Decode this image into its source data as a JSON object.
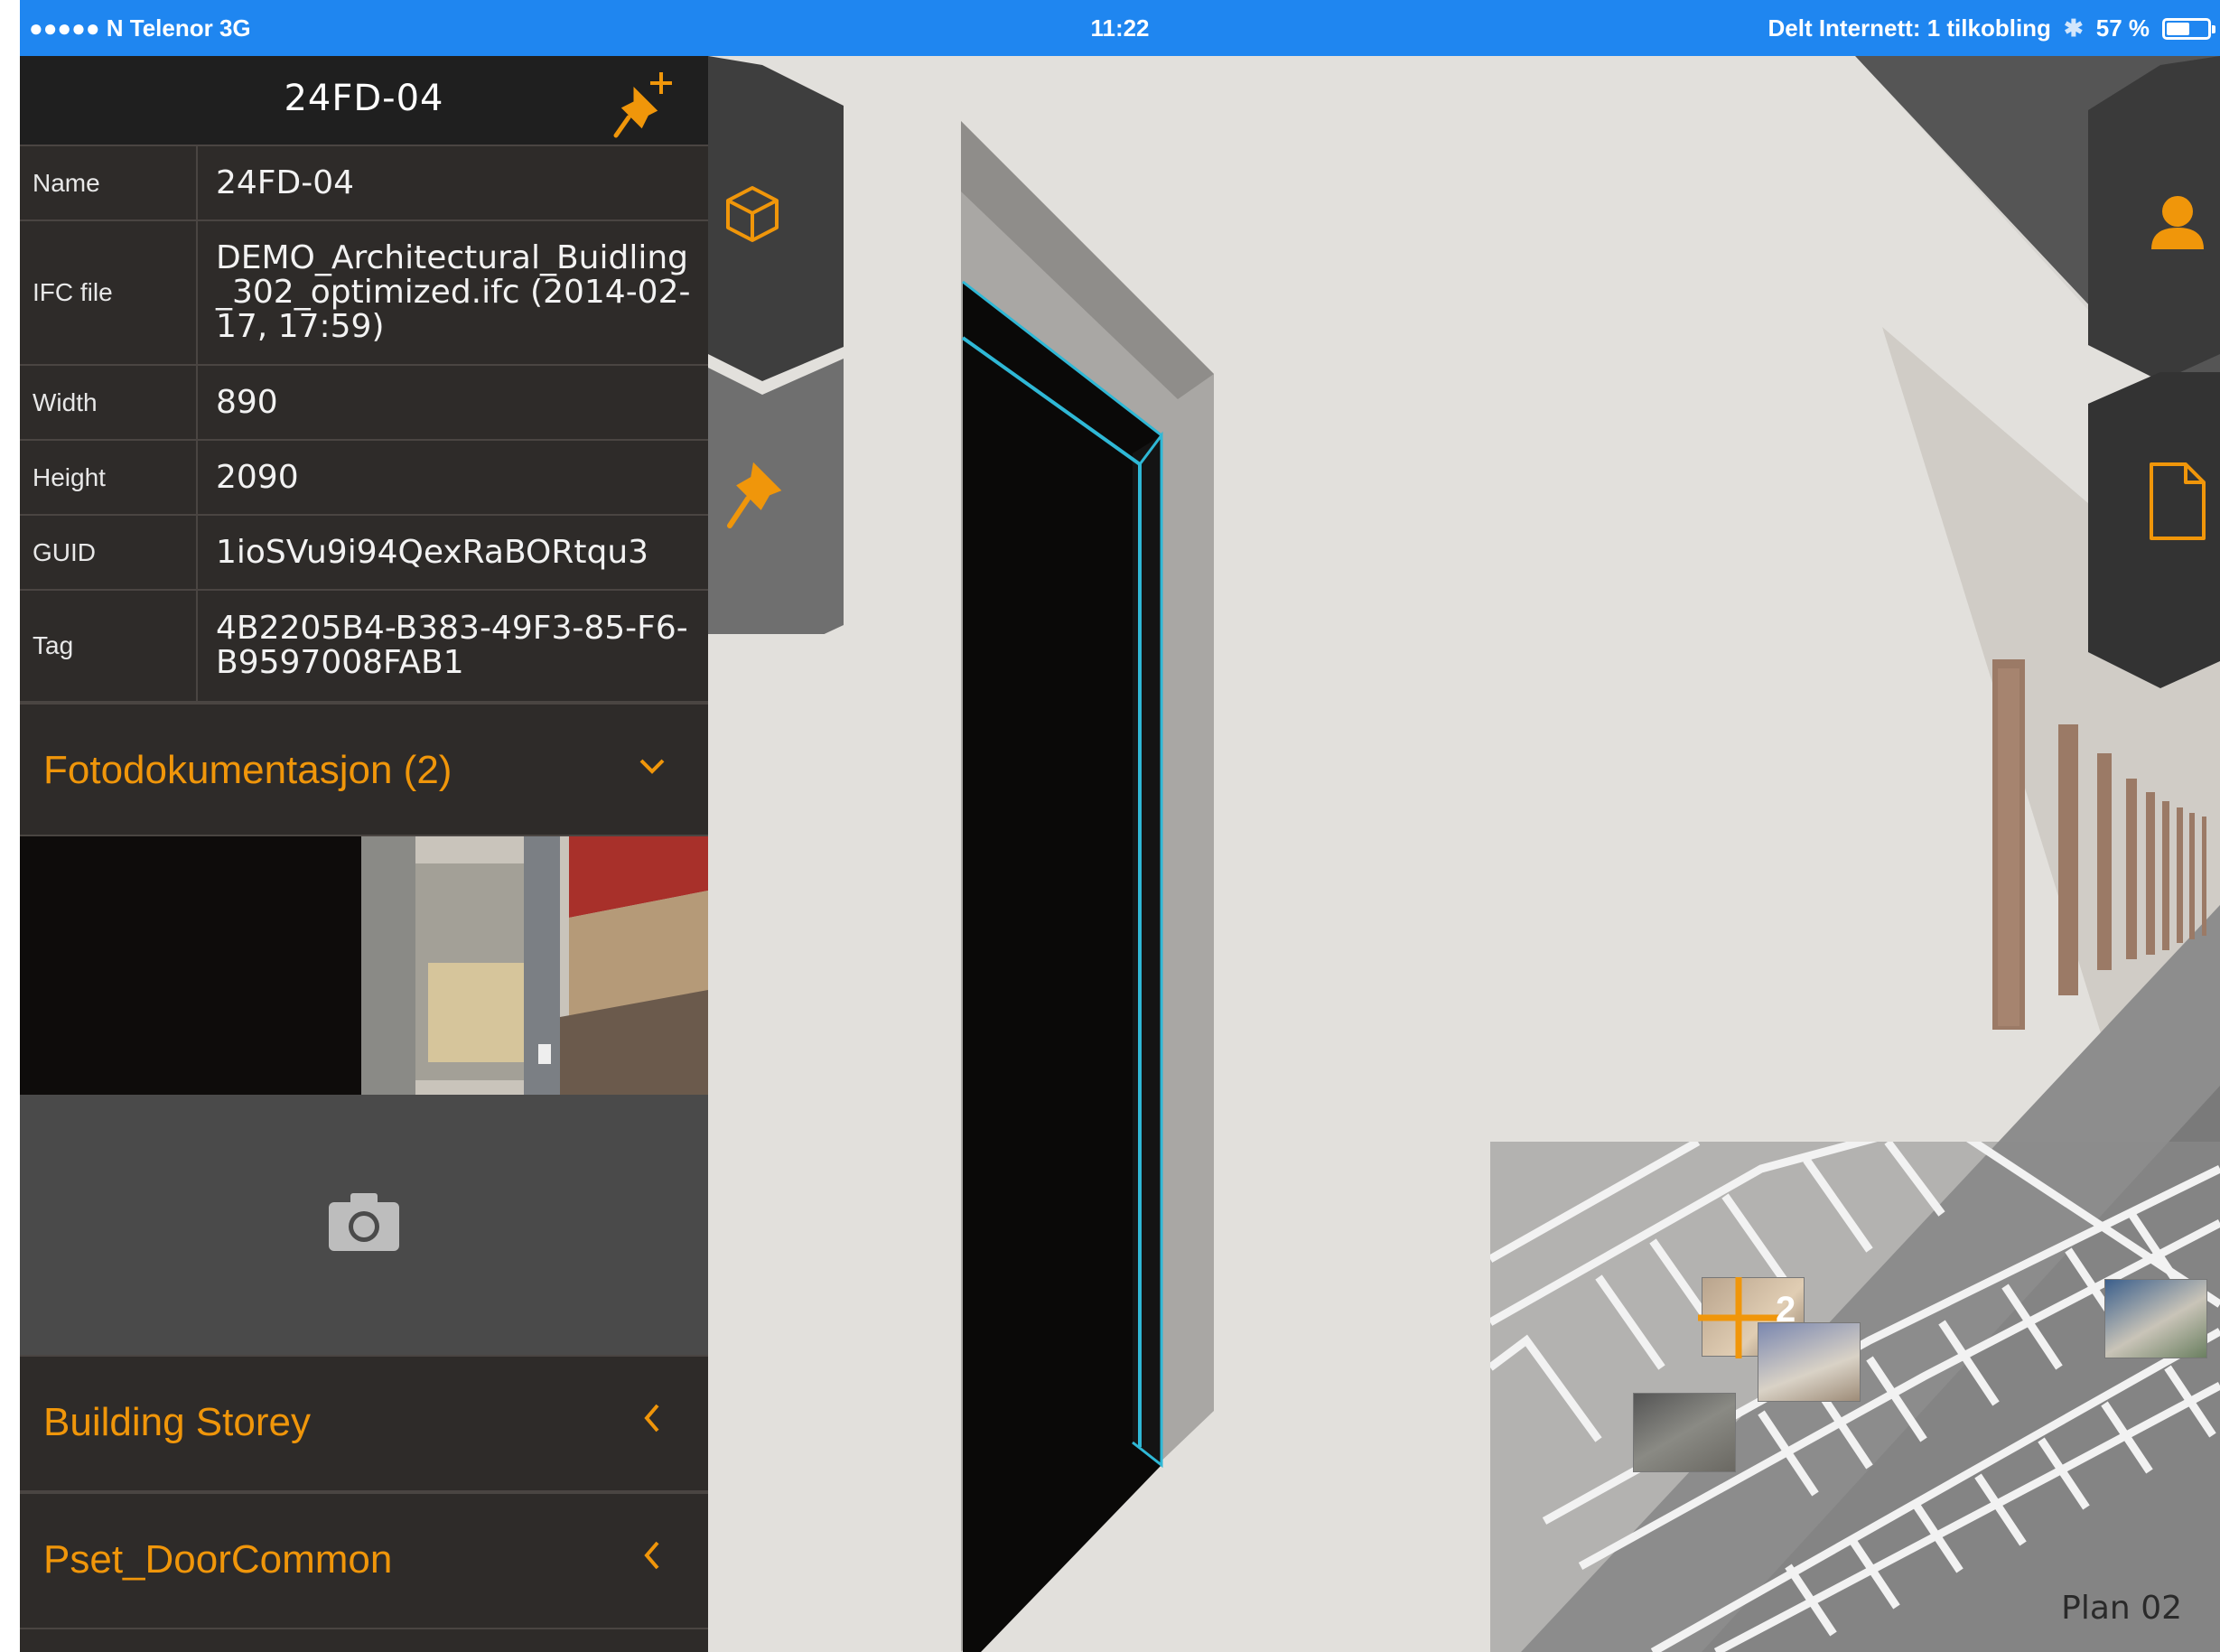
{
  "status_bar": {
    "carrier": "●●●●● N Telenor   3G",
    "time": "11:22",
    "hotspot": "Delt Internett: 1 tilkobling",
    "battery": "57 %",
    "battery_level": 0.57
  },
  "panel": {
    "title": "24FD-04",
    "properties": [
      {
        "key": "Name",
        "value": "24FD-04"
      },
      {
        "key": "IFC file",
        "value": "DEMO_Architectural_Buidling_302_optimized.ifc (2014-02-17, 17:59)"
      },
      {
        "key": "Width",
        "value": "890"
      },
      {
        "key": "Height",
        "value": "2090"
      },
      {
        "key": "GUID",
        "value": "1ioSVu9i94QexRaBORtqu3"
      },
      {
        "key": "Tag",
        "value": "4B2205B4-B383-49F3-85-F6-B9597008FAB1"
      }
    ],
    "photo_section": {
      "label": "Fotodokumentasjon (2)",
      "state": "expanded"
    },
    "sections": [
      {
        "label": "Building Storey",
        "state": "collapsed"
      },
      {
        "label": "Pset_DoorCommon",
        "state": "collapsed"
      }
    ]
  },
  "minimap": {
    "plan_label": "Plan 02",
    "marker_count": "2"
  },
  "colors": {
    "accent": "#f0960a",
    "status_bar": "#1f86f0",
    "panel": "#2e2b29",
    "highlight": "#2fb8d6"
  },
  "icons": {
    "pin_add": "pin-plus-icon",
    "model_tab": "cube-icon",
    "pin_tab": "pin-icon",
    "user_tab": "user-icon",
    "document_tab": "document-icon",
    "camera": "camera-icon"
  }
}
